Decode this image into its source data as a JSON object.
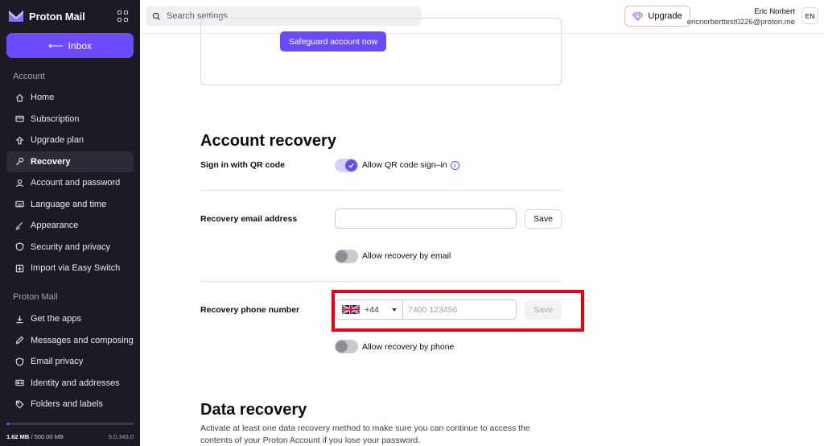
{
  "sidebar": {
    "brand": "Proton Mail",
    "inbox_label": "Inbox",
    "account_section": "Account",
    "account_items": [
      {
        "label": "Home",
        "icon": "home-icon"
      },
      {
        "label": "Subscription",
        "icon": "credit-card-icon"
      },
      {
        "label": "Upgrade plan",
        "icon": "upgrade-arrow-icon"
      },
      {
        "label": "Recovery",
        "icon": "key-icon",
        "active": true
      },
      {
        "label": "Account and password",
        "icon": "user-icon"
      },
      {
        "label": "Language and time",
        "icon": "keyboard-icon"
      },
      {
        "label": "Appearance",
        "icon": "paint-brush-icon"
      },
      {
        "label": "Security and privacy",
        "icon": "shield-icon"
      },
      {
        "label": "Import via Easy Switch",
        "icon": "import-icon"
      }
    ],
    "mail_section": "Proton Mail",
    "mail_items": [
      {
        "label": "Get the apps",
        "icon": "download-icon"
      },
      {
        "label": "Messages and composing",
        "icon": "pen-icon"
      },
      {
        "label": "Email privacy",
        "icon": "shield-icon"
      },
      {
        "label": "Identity and addresses",
        "icon": "id-card-icon"
      },
      {
        "label": "Folders and labels",
        "icon": "tag-icon"
      }
    ],
    "storage_used": "1.62 MB",
    "storage_total": "/ 500.00 MB",
    "storage_fraction": 0.003,
    "version": "5.0.343.0"
  },
  "header": {
    "search_placeholder": "Search settings",
    "upgrade_label": "Upgrade",
    "user_name": "Eric Norbert",
    "user_email": "ericnorberttest0226@proton.me",
    "lang": "EN"
  },
  "main": {
    "safeguard_button": "Safeguard account now",
    "account_recovery_title": "Account recovery",
    "qr_label": "Sign in with QR code",
    "qr_toggle_label": "Allow QR code sign–in",
    "qr_toggle_on": true,
    "recovery_email_label": "Recovery email address",
    "recovery_email_value": "",
    "save_label": "Save",
    "email_toggle_label": "Allow recovery by email",
    "recovery_phone_label": "Recovery phone number",
    "country_code": "+44",
    "phone_placeholder": "7400 123456",
    "phone_toggle_label": "Allow recovery by phone",
    "data_recovery_title": "Data recovery",
    "data_recovery_text": "Activate at least one data recovery method to make sure you can continue to access the contents of your Proton Account if you lose your password."
  },
  "colors": {
    "accent": "#6d4aff",
    "sidebar_bg": "#1c1b24",
    "highlight": "#e8000e"
  }
}
